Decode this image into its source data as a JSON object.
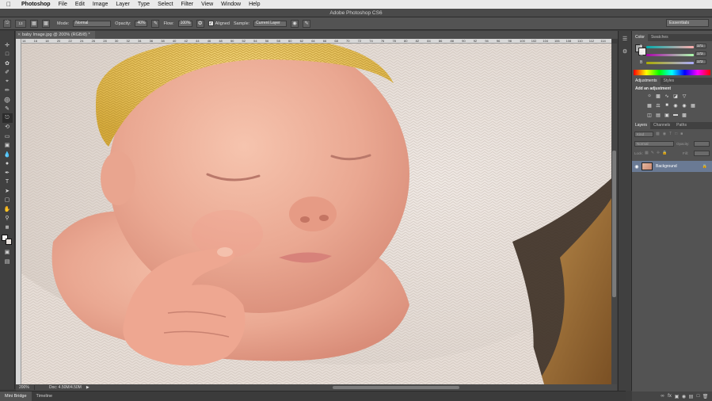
{
  "menubar": {
    "apple": "",
    "items": [
      "Photoshop",
      "File",
      "Edit",
      "Image",
      "Layer",
      "Type",
      "Select",
      "Filter",
      "View",
      "Window",
      "Help"
    ]
  },
  "titlebar": {
    "title": "Adobe Photoshop CS6"
  },
  "options": {
    "brush_size": "13",
    "mode_label": "Mode:",
    "mode_value": "Normal",
    "opacity_label": "Opacity:",
    "opacity_value": "40%",
    "flow_label": "Flow:",
    "flow_value": "100%",
    "aligned_label": "Aligned",
    "sample_label": "Sample:",
    "sample_value": "Current Layer",
    "workspace": "Essentials"
  },
  "document": {
    "tab_title": "baby Image.jpg @ 200% (RGB/8) *",
    "ruler_ticks": [
      "14",
      "16",
      "18",
      "20",
      "22",
      "24",
      "26",
      "28",
      "30",
      "32",
      "34",
      "36",
      "38",
      "40",
      "42",
      "44",
      "46",
      "48",
      "50",
      "52",
      "54",
      "56",
      "58",
      "60",
      "62",
      "64",
      "66",
      "68",
      "70",
      "72",
      "74",
      "76",
      "78",
      "80",
      "82",
      "84",
      "86",
      "88",
      "90",
      "92",
      "94",
      "96",
      "98",
      "100",
      "102",
      "104",
      "106",
      "108",
      "110",
      "112",
      "114"
    ]
  },
  "status": {
    "zoom": "200%",
    "doc": "Doc: 4.50M/4.50M"
  },
  "bottom_tabs": [
    "Mini Bridge",
    "Timeline"
  ],
  "color_panel": {
    "tabs": [
      "Color",
      "Swatches"
    ],
    "channels": [
      {
        "label": "R",
        "value": "171"
      },
      {
        "label": "G",
        "value": "172"
      },
      {
        "label": "B",
        "value": "172"
      }
    ]
  },
  "adjust_panel": {
    "tabs": [
      "Adjustments",
      "Styles"
    ],
    "heading": "Add an adjustment"
  },
  "layers_panel": {
    "tabs": [
      "Layers",
      "Channels",
      "Paths"
    ],
    "kind": "Kind",
    "blend": "Normal",
    "opacity_label": "Opacity:",
    "lock_label": "Lock:",
    "fill_label": "Fill:",
    "layer_name": "Background"
  },
  "colors": {
    "accent": "#6a7a94"
  }
}
